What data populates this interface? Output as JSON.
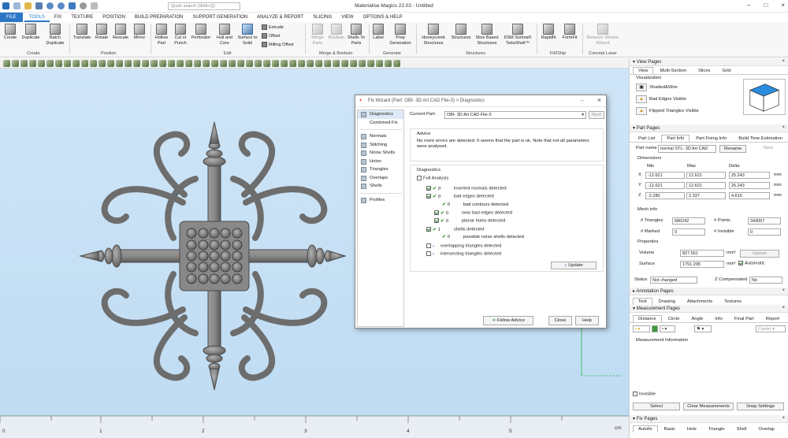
{
  "window": {
    "title": "Materialise Magics 22.03 - Untitled",
    "search_placeholder": "Quick search (Shift+Q)"
  },
  "menu": [
    "FILE",
    "TOOLS",
    "FIX",
    "TEXTURE",
    "POSITION",
    "BUILD PREPARATION",
    "SUPPORT GENERATION",
    "ANALYZE & REPORT",
    "SLICING",
    "VIEW",
    "OPTIONS & HELP"
  ],
  "ribbon": {
    "buttons": [
      "Create",
      "Duplicate",
      "Batch Duplicate",
      "Translate",
      "Rotate",
      "Rescale",
      "Mirror",
      "Hollow Part",
      "Cut or Punch",
      "Perforator",
      "Hull and Core",
      "Surface to Solid",
      "Merge Parts",
      "Boolean",
      "Shells To Parts",
      "Label",
      "Prep Generation",
      "Honeycomb Structures",
      "Structures",
      "Slice Based Structures",
      "DSM Somos® TetraShell™",
      "Rapidfit",
      "FormFit",
      "Remove Volume Wizard"
    ],
    "small": [
      "Extrude",
      "Offset",
      "Milling Offset"
    ],
    "groups": [
      "Create",
      "Position",
      "Edit",
      "Merge & Boolean",
      "Generate",
      "Structures",
      "Fit2Ship",
      "Concept Laser"
    ]
  },
  "ruler": {
    "ticks": [
      "0",
      "1",
      "2",
      "3",
      "4",
      "5"
    ],
    "unit": "cm"
  },
  "view_pages": {
    "title": "View Pages",
    "tabs": [
      "View",
      "Multi-Section",
      "Slices",
      "Grid"
    ],
    "section": "Visualization",
    "options": [
      "Shaded&Wire",
      "Bad Edges Visible",
      "Flipped Triangles Visible"
    ]
  },
  "part_pages": {
    "title": "Part Pages",
    "tabs": [
      "Part List",
      "Part Info",
      "Part Fixing Info",
      "Build Time Estimation"
    ],
    "part_name_label": "Part name",
    "part_name": "normal STL- 3D Art CAD",
    "rename": "Rename",
    "next": "Next",
    "dims_title": "Dimensions",
    "dim_headers": [
      "Min",
      "Max",
      "Delta"
    ],
    "dims": [
      {
        "axis": "X",
        "min": "-12.621",
        "max": "12.621",
        "delta": "25.243",
        "unit": "mm"
      },
      {
        "axis": "Y",
        "min": "-12.621",
        "max": "12.621",
        "delta": "25.243",
        "unit": "mm"
      },
      {
        "axis": "Z",
        "min": "-2.280",
        "max": "2.337",
        "delta": "4.616",
        "unit": "mm"
      }
    ],
    "mesh_title": "Mesh info",
    "triangles_label": "# Triangles",
    "triangles": "686242",
    "points_label": "# Points",
    "points": "343057",
    "marked_label": "# Marked",
    "marked": "0",
    "invisible_label": "# Invisible",
    "invisible": "0",
    "props_title": "Properties",
    "volume_label": "Volume",
    "volume": "827.551",
    "volume_unit": "mm³",
    "update": "Update",
    "surface_label": "Surface",
    "surface": "1751.295",
    "surface_unit": "mm²",
    "automatic": "Automatic",
    "status_label": "Status",
    "status": "Not changed",
    "zcomp_label": "Z Compensated",
    "zcomp": "No"
  },
  "annotation_pages": {
    "title": "Annotation Pages",
    "tabs": [
      "Text",
      "Drawing",
      "Attachments",
      "Textures"
    ]
  },
  "measurement_pages": {
    "title": "Measurement Pages",
    "tabs": [
      "Distance",
      "Circle",
      "Angle",
      "Info",
      "Final Part",
      "Report"
    ],
    "center": "Center",
    "info": "Measurement Information",
    "invisible": "Invisible",
    "buttons": [
      "Select",
      "Clear Measurements",
      "Snap Settings"
    ]
  },
  "fix_pages": {
    "title": "Fix Pages",
    "tabs": [
      "Autofix",
      "Basic",
      "Hole",
      "Triangle",
      "Shell",
      "Overlap"
    ]
  },
  "dialog": {
    "title": "Fix Wizard (Part: OBI- 3D Art CAD File-3) > Diagnostics",
    "current_part_label": "Current Part:",
    "current_part": "OBI- 3D Art CAD File-3",
    "next": "Next",
    "side_top": [
      "Diagnostics",
      "Combined Fix"
    ],
    "side_mid": [
      "Normals",
      "Stitching",
      "Noise Shells",
      "Holes",
      "Triangles",
      "Overlaps",
      "Shells"
    ],
    "side_bot": [
      "Profiles"
    ],
    "advice_title": "Advice",
    "advice": "No more errors are detected. It seems that the part is ok. Note that not all parameters were analysed.",
    "diag_title": "Diagnostics",
    "full_analysis": "Full Analysis",
    "items": [
      {
        "count": "0",
        "label": "inverted normals detected"
      },
      {
        "count": "0",
        "label": "bad edges detected"
      },
      {
        "count": "0",
        "label": "bad contours detected"
      },
      {
        "count": "0",
        "label": "near bad edges detected"
      },
      {
        "count": "0",
        "label": "planar holes detected"
      },
      {
        "count": "1",
        "label": "shells detected"
      },
      {
        "count": "0",
        "label": "possible noise shells detected"
      },
      {
        "count": "-",
        "label": "overlapping triangles detected"
      },
      {
        "count": "-",
        "label": "intersecting triangles detected"
      }
    ],
    "update": "Update",
    "follow": "Follow Advice",
    "close": "Close",
    "help": "Help"
  },
  "colors": {
    "accent": "#2b77c6",
    "viewport": "#c8e1f5",
    "model": "#7b7b7b"
  }
}
